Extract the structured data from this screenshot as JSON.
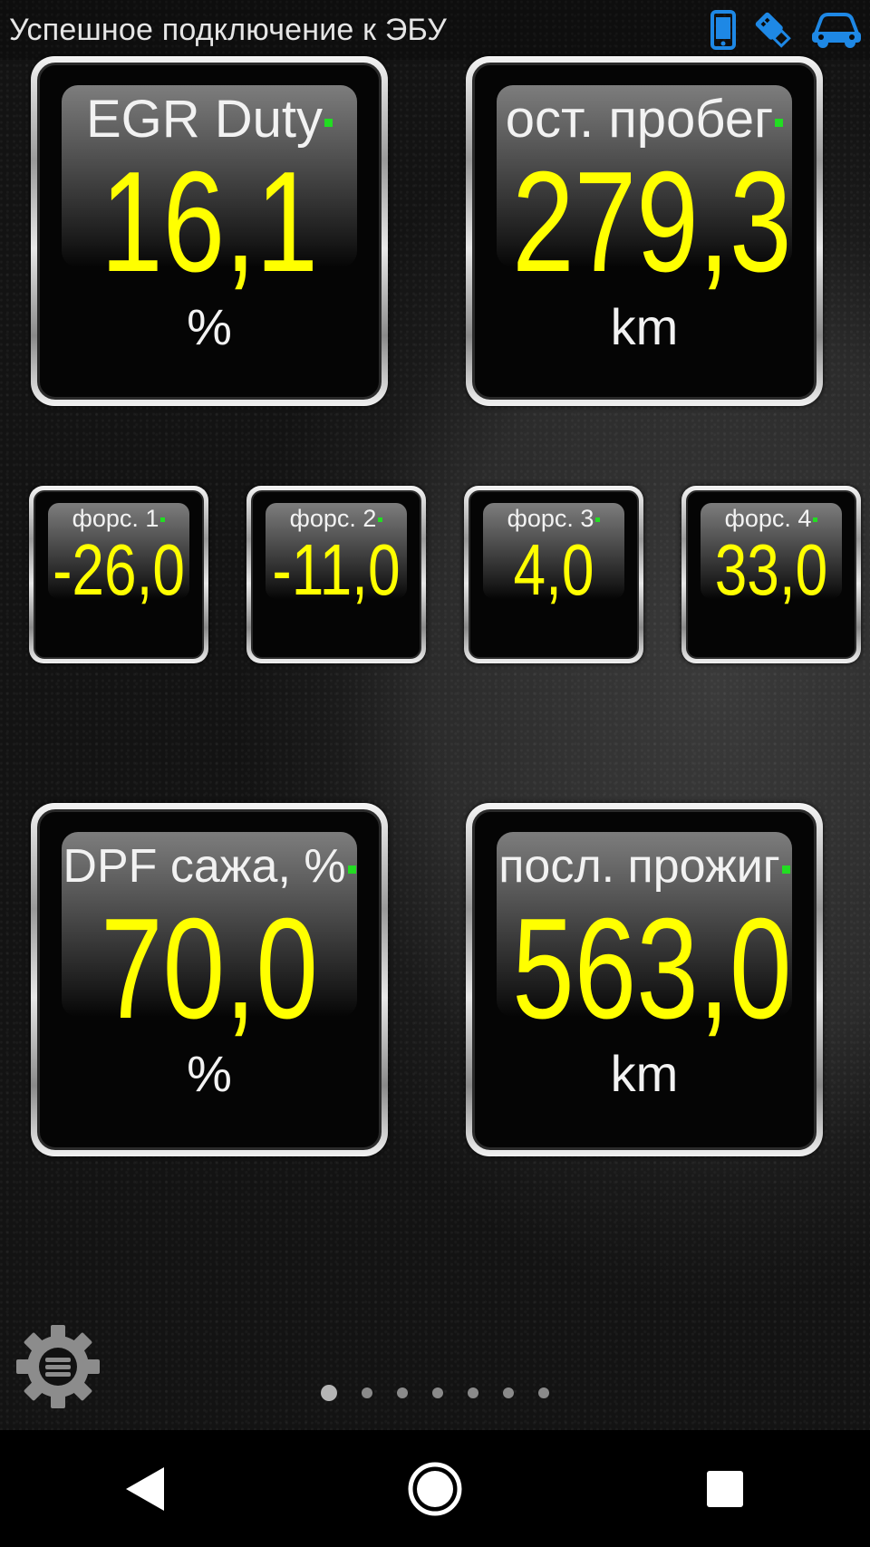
{
  "status_bar": {
    "text": "Успешное подключение к ЭБУ",
    "icons": [
      "phone-icon",
      "usb-adapter-icon",
      "car-icon"
    ],
    "icon_color": "#1e88e5"
  },
  "gauges": [
    {
      "label": "EGR Duty",
      "value": "16,1",
      "unit": "%"
    },
    {
      "label": "ост. пробег",
      "value": "279,3",
      "unit": "km"
    },
    {
      "label": "форс. 1",
      "value": "-26,0",
      "unit": ""
    },
    {
      "label": "форс. 2",
      "value": "-11,0",
      "unit": ""
    },
    {
      "label": "форс. 3",
      "value": "4,0",
      "unit": ""
    },
    {
      "label": "форс. 4",
      "value": "33,0",
      "unit": ""
    },
    {
      "label": "DPF сажа, %",
      "value": "70,0",
      "unit": "%"
    },
    {
      "label": "посл. прожиг",
      "value": "563,0",
      "unit": "km"
    }
  ],
  "colors": {
    "value": "#ffff00",
    "label": "#f2f2f2",
    "indicator": "#22dd22"
  },
  "pager": {
    "total_pages": 7,
    "current_page": 1
  },
  "navbar": {
    "buttons": [
      "back-icon",
      "home-icon",
      "recents-icon"
    ]
  }
}
